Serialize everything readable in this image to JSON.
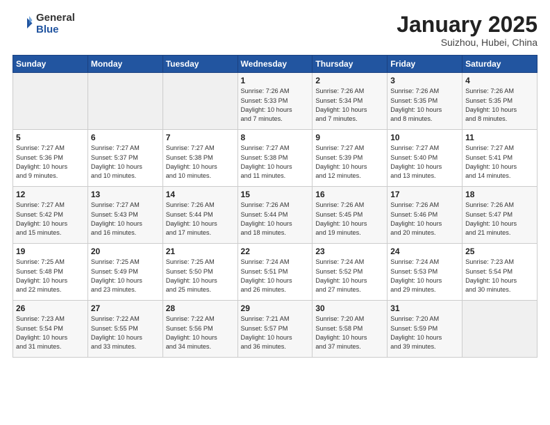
{
  "header": {
    "logo_general": "General",
    "logo_blue": "Blue",
    "month": "January 2025",
    "location": "Suizhou, Hubei, China"
  },
  "weekdays": [
    "Sunday",
    "Monday",
    "Tuesday",
    "Wednesday",
    "Thursday",
    "Friday",
    "Saturday"
  ],
  "weeks": [
    [
      {
        "day": "",
        "info": ""
      },
      {
        "day": "",
        "info": ""
      },
      {
        "day": "",
        "info": ""
      },
      {
        "day": "1",
        "info": "Sunrise: 7:26 AM\nSunset: 5:33 PM\nDaylight: 10 hours\nand 7 minutes."
      },
      {
        "day": "2",
        "info": "Sunrise: 7:26 AM\nSunset: 5:34 PM\nDaylight: 10 hours\nand 7 minutes."
      },
      {
        "day": "3",
        "info": "Sunrise: 7:26 AM\nSunset: 5:35 PM\nDaylight: 10 hours\nand 8 minutes."
      },
      {
        "day": "4",
        "info": "Sunrise: 7:26 AM\nSunset: 5:35 PM\nDaylight: 10 hours\nand 8 minutes."
      }
    ],
    [
      {
        "day": "5",
        "info": "Sunrise: 7:27 AM\nSunset: 5:36 PM\nDaylight: 10 hours\nand 9 minutes."
      },
      {
        "day": "6",
        "info": "Sunrise: 7:27 AM\nSunset: 5:37 PM\nDaylight: 10 hours\nand 10 minutes."
      },
      {
        "day": "7",
        "info": "Sunrise: 7:27 AM\nSunset: 5:38 PM\nDaylight: 10 hours\nand 10 minutes."
      },
      {
        "day": "8",
        "info": "Sunrise: 7:27 AM\nSunset: 5:38 PM\nDaylight: 10 hours\nand 11 minutes."
      },
      {
        "day": "9",
        "info": "Sunrise: 7:27 AM\nSunset: 5:39 PM\nDaylight: 10 hours\nand 12 minutes."
      },
      {
        "day": "10",
        "info": "Sunrise: 7:27 AM\nSunset: 5:40 PM\nDaylight: 10 hours\nand 13 minutes."
      },
      {
        "day": "11",
        "info": "Sunrise: 7:27 AM\nSunset: 5:41 PM\nDaylight: 10 hours\nand 14 minutes."
      }
    ],
    [
      {
        "day": "12",
        "info": "Sunrise: 7:27 AM\nSunset: 5:42 PM\nDaylight: 10 hours\nand 15 minutes."
      },
      {
        "day": "13",
        "info": "Sunrise: 7:27 AM\nSunset: 5:43 PM\nDaylight: 10 hours\nand 16 minutes."
      },
      {
        "day": "14",
        "info": "Sunrise: 7:26 AM\nSunset: 5:44 PM\nDaylight: 10 hours\nand 17 minutes."
      },
      {
        "day": "15",
        "info": "Sunrise: 7:26 AM\nSunset: 5:44 PM\nDaylight: 10 hours\nand 18 minutes."
      },
      {
        "day": "16",
        "info": "Sunrise: 7:26 AM\nSunset: 5:45 PM\nDaylight: 10 hours\nand 19 minutes."
      },
      {
        "day": "17",
        "info": "Sunrise: 7:26 AM\nSunset: 5:46 PM\nDaylight: 10 hours\nand 20 minutes."
      },
      {
        "day": "18",
        "info": "Sunrise: 7:26 AM\nSunset: 5:47 PM\nDaylight: 10 hours\nand 21 minutes."
      }
    ],
    [
      {
        "day": "19",
        "info": "Sunrise: 7:25 AM\nSunset: 5:48 PM\nDaylight: 10 hours\nand 22 minutes."
      },
      {
        "day": "20",
        "info": "Sunrise: 7:25 AM\nSunset: 5:49 PM\nDaylight: 10 hours\nand 23 minutes."
      },
      {
        "day": "21",
        "info": "Sunrise: 7:25 AM\nSunset: 5:50 PM\nDaylight: 10 hours\nand 25 minutes."
      },
      {
        "day": "22",
        "info": "Sunrise: 7:24 AM\nSunset: 5:51 PM\nDaylight: 10 hours\nand 26 minutes."
      },
      {
        "day": "23",
        "info": "Sunrise: 7:24 AM\nSunset: 5:52 PM\nDaylight: 10 hours\nand 27 minutes."
      },
      {
        "day": "24",
        "info": "Sunrise: 7:24 AM\nSunset: 5:53 PM\nDaylight: 10 hours\nand 29 minutes."
      },
      {
        "day": "25",
        "info": "Sunrise: 7:23 AM\nSunset: 5:54 PM\nDaylight: 10 hours\nand 30 minutes."
      }
    ],
    [
      {
        "day": "26",
        "info": "Sunrise: 7:23 AM\nSunset: 5:54 PM\nDaylight: 10 hours\nand 31 minutes."
      },
      {
        "day": "27",
        "info": "Sunrise: 7:22 AM\nSunset: 5:55 PM\nDaylight: 10 hours\nand 33 minutes."
      },
      {
        "day": "28",
        "info": "Sunrise: 7:22 AM\nSunset: 5:56 PM\nDaylight: 10 hours\nand 34 minutes."
      },
      {
        "day": "29",
        "info": "Sunrise: 7:21 AM\nSunset: 5:57 PM\nDaylight: 10 hours\nand 36 minutes."
      },
      {
        "day": "30",
        "info": "Sunrise: 7:20 AM\nSunset: 5:58 PM\nDaylight: 10 hours\nand 37 minutes."
      },
      {
        "day": "31",
        "info": "Sunrise: 7:20 AM\nSunset: 5:59 PM\nDaylight: 10 hours\nand 39 minutes."
      },
      {
        "day": "",
        "info": ""
      }
    ]
  ]
}
